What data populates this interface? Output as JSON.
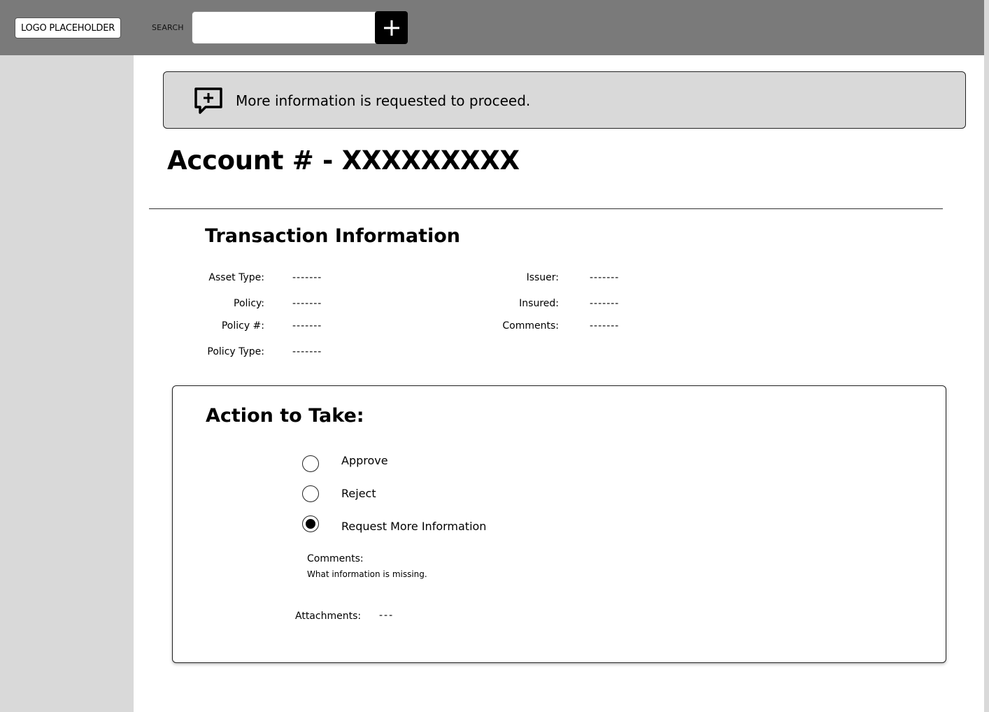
{
  "header": {
    "logo": "LOGO PLACEHOLDER",
    "search_label": "SEARCH",
    "search_value": "",
    "add_button_icon": "plus-icon"
  },
  "notice": {
    "icon": "message-plus-icon",
    "text": "More information is requested to proceed."
  },
  "account": {
    "title": "Account # - XXXXXXXXX"
  },
  "transaction": {
    "title": "Transaction Information",
    "fields": [
      {
        "label": "Asset Type:",
        "value": "-------"
      },
      {
        "label": "Policy:",
        "value": "-------"
      },
      {
        "label": "Policy #:",
        "value": "-------"
      },
      {
        "label": "Policy Type:",
        "value": "-------"
      },
      {
        "label": "Issuer:",
        "value": "-------"
      },
      {
        "label": "Insured:",
        "value": "-------"
      },
      {
        "label": "Comments:",
        "value": "-------"
      }
    ]
  },
  "action": {
    "title": "Action to Take:",
    "options": [
      {
        "label": "Approve",
        "selected": false
      },
      {
        "label": "Reject",
        "selected": false
      },
      {
        "label": "Request More Information",
        "selected": true
      }
    ],
    "comments_label": "Comments:",
    "comments_text": "What information is missing.",
    "attachments_label": "Attachments:",
    "attachments_value": "---"
  }
}
